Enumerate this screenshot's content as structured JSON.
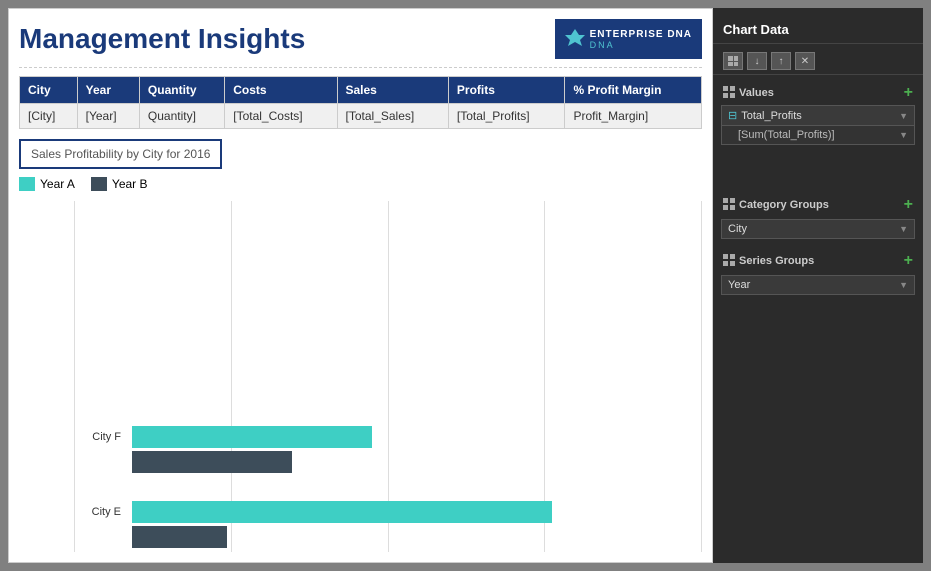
{
  "header": {
    "title": "Management Insights",
    "logo": {
      "icon": "✦",
      "brand": "ENTERPRISE DNA",
      "sub": "DNA"
    }
  },
  "table": {
    "columns": [
      "City",
      "Year",
      "Quantity",
      "Costs",
      "Sales",
      "Profits",
      "% Profit Margin"
    ],
    "row": [
      "[City]",
      "[Year]",
      "Quantity]",
      "[Total_Costs]",
      "[Total_Sales]",
      "[Total_Profits]",
      "Profit_Margin]"
    ]
  },
  "chart": {
    "title": "Sales Profitability by City for 2016",
    "legend": {
      "year_a": "Year A",
      "year_b": "Year B"
    },
    "bars": [
      {
        "city": "City F",
        "year_a_width": 240,
        "year_b_width": 160
      },
      {
        "city": "City E",
        "year_a_width": 420,
        "year_b_width": 95
      }
    ]
  },
  "sidebar": {
    "title": "Chart Data",
    "toolbar": {
      "btn1": "⊞",
      "btn2": "↓",
      "btn3": "↑",
      "btn4": "✕"
    },
    "values_section": {
      "label": "Values",
      "field1": "Total_Profits",
      "field1_sub": "[Sum(Total_Profits)]"
    },
    "category_section": {
      "label": "Category Groups",
      "field": "City"
    },
    "series_section": {
      "label": "Series Groups",
      "field": "Year"
    }
  }
}
